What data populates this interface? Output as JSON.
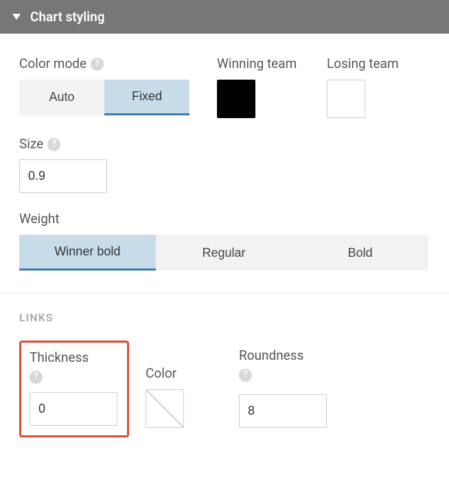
{
  "header": {
    "title": "Chart styling"
  },
  "colorMode": {
    "label": "Color mode",
    "options": {
      "auto": "Auto",
      "fixed": "Fixed"
    }
  },
  "winningTeam": {
    "label": "Winning team"
  },
  "losingTeam": {
    "label": "Losing team"
  },
  "size": {
    "label": "Size",
    "value": "0.9"
  },
  "weight": {
    "label": "Weight",
    "options": {
      "winnerBold": "Winner bold",
      "regular": "Regular",
      "bold": "Bold"
    }
  },
  "links": {
    "sectionLabel": "LINKS",
    "thickness": {
      "label": "Thickness",
      "value": "0"
    },
    "color": {
      "label": "Color"
    },
    "roundness": {
      "label": "Roundness",
      "value": "8"
    }
  }
}
